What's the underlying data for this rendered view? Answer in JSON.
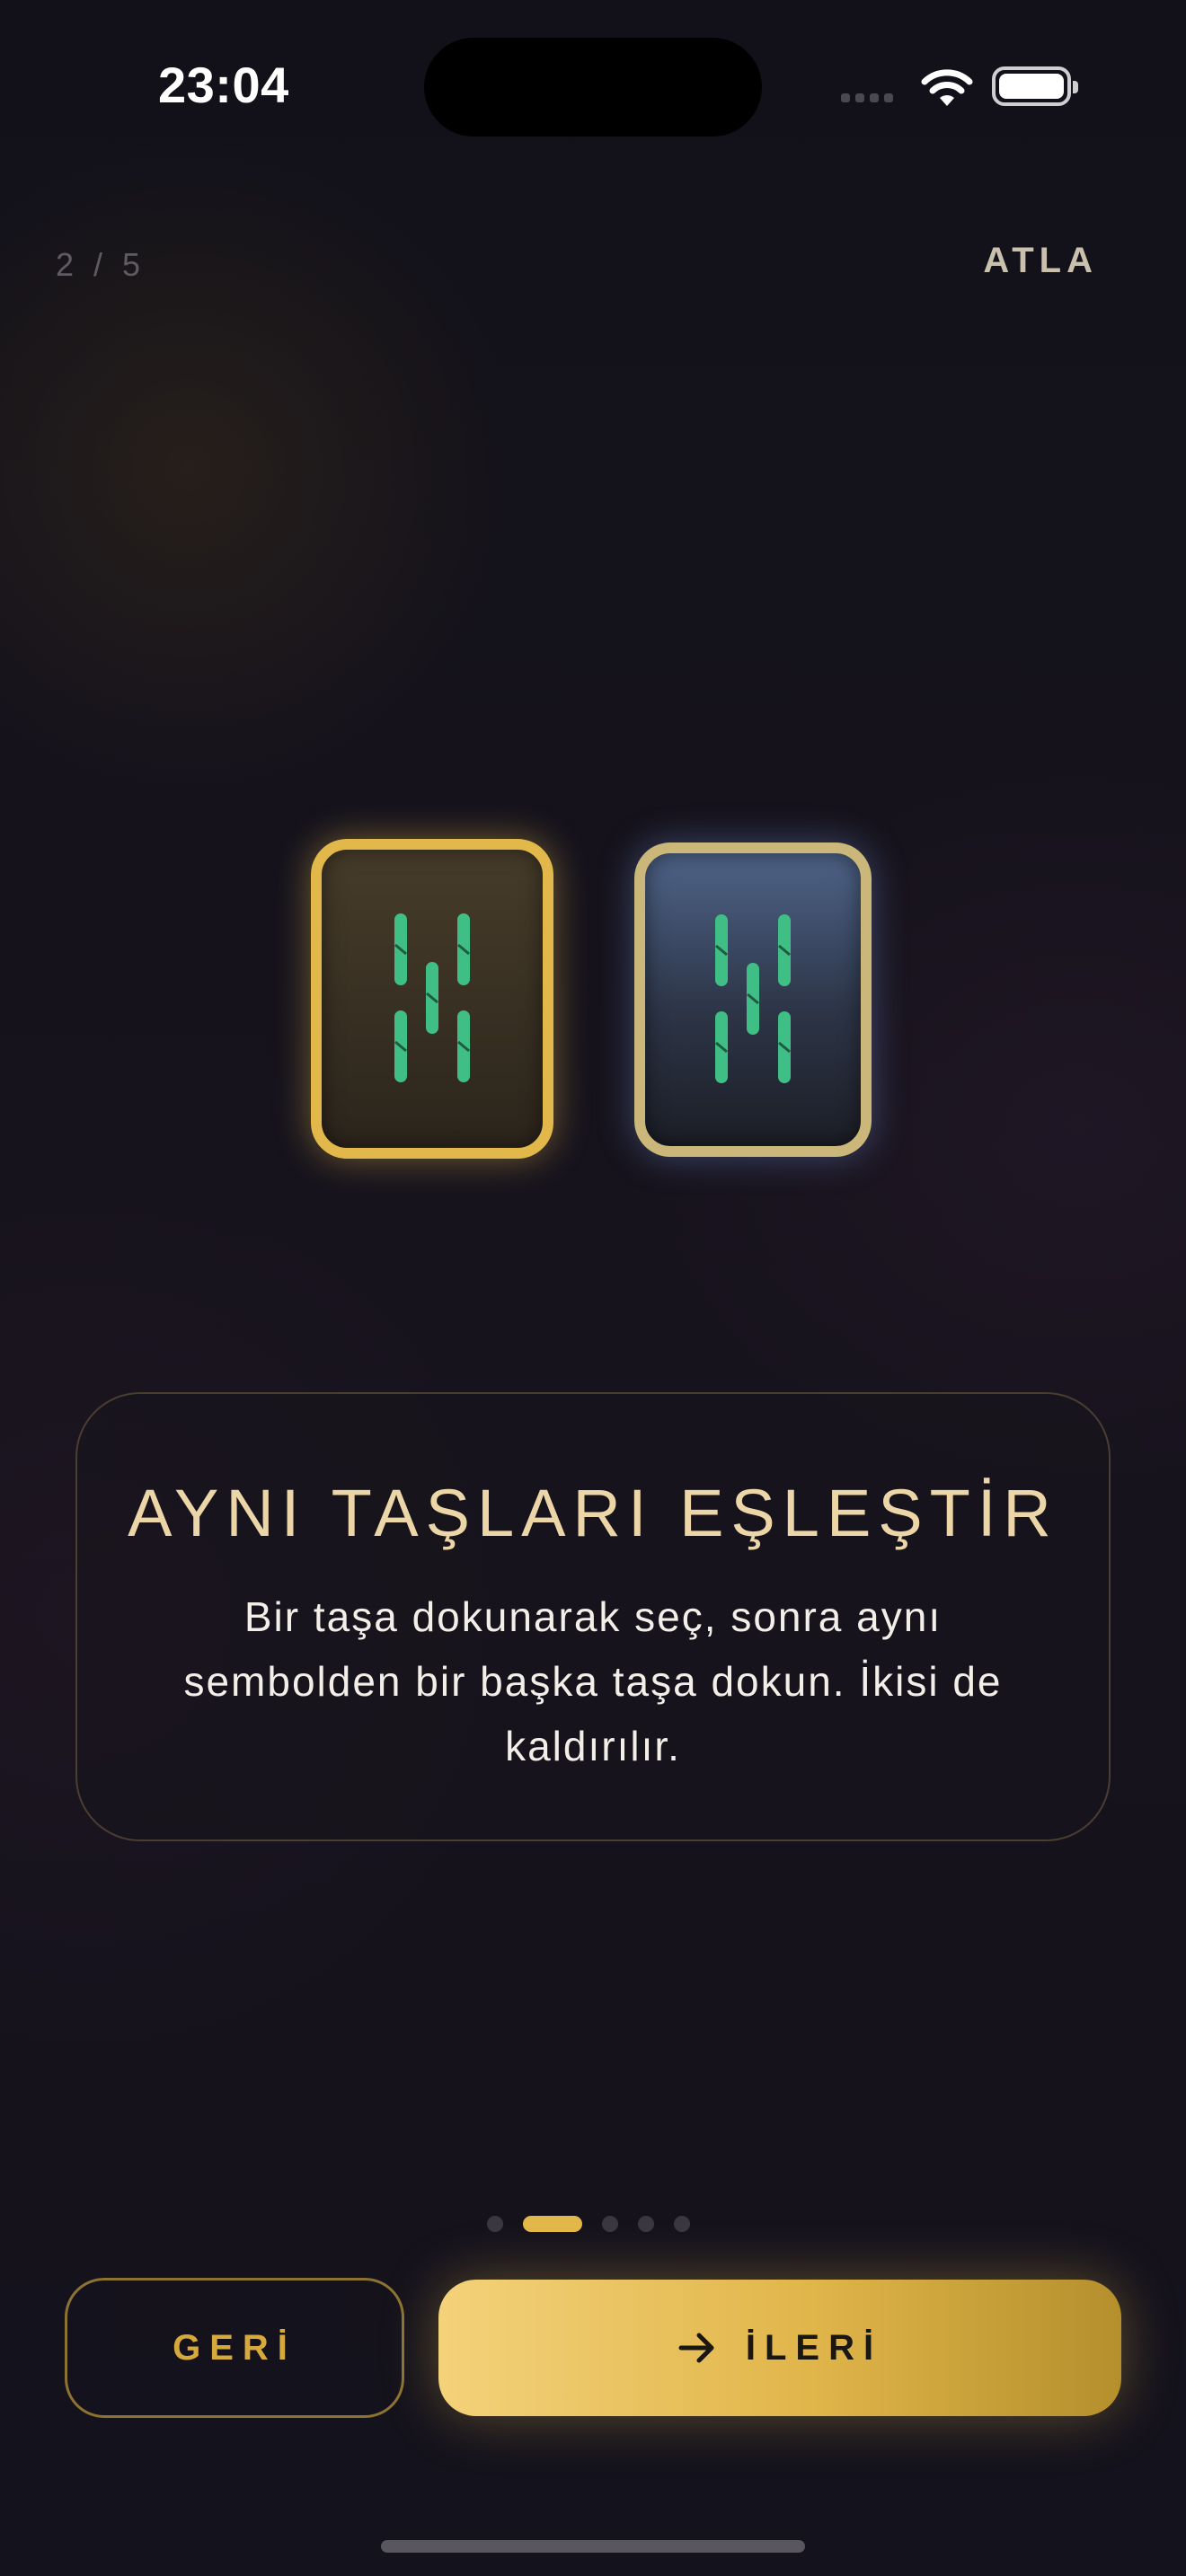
{
  "status_bar": {
    "time": "23:04"
  },
  "header": {
    "progress": "2 / 5",
    "skip_label": "ATLA"
  },
  "tiles": [
    {
      "style": "gold-selected",
      "accent": "#e2b84a",
      "symbol_color": "#3fbf86"
    },
    {
      "style": "blue-selected",
      "accent": "#cbb77a",
      "symbol_color": "#3fbf86"
    }
  ],
  "card": {
    "title": "AYNI TAŞLARI EŞLEŞTİR",
    "body": "Bir taşa dokunarak seç, sonra aynı sembolden bir başka taşa dokun. İkisi de kaldırılır."
  },
  "pager": {
    "count": 5,
    "active_index": 1
  },
  "buttons": {
    "back_label": "GERİ",
    "next_label": "İLERİ",
    "next_icon": "arrow-right-icon"
  },
  "colors": {
    "accent": "#e2b84a",
    "background": "#14121c"
  }
}
